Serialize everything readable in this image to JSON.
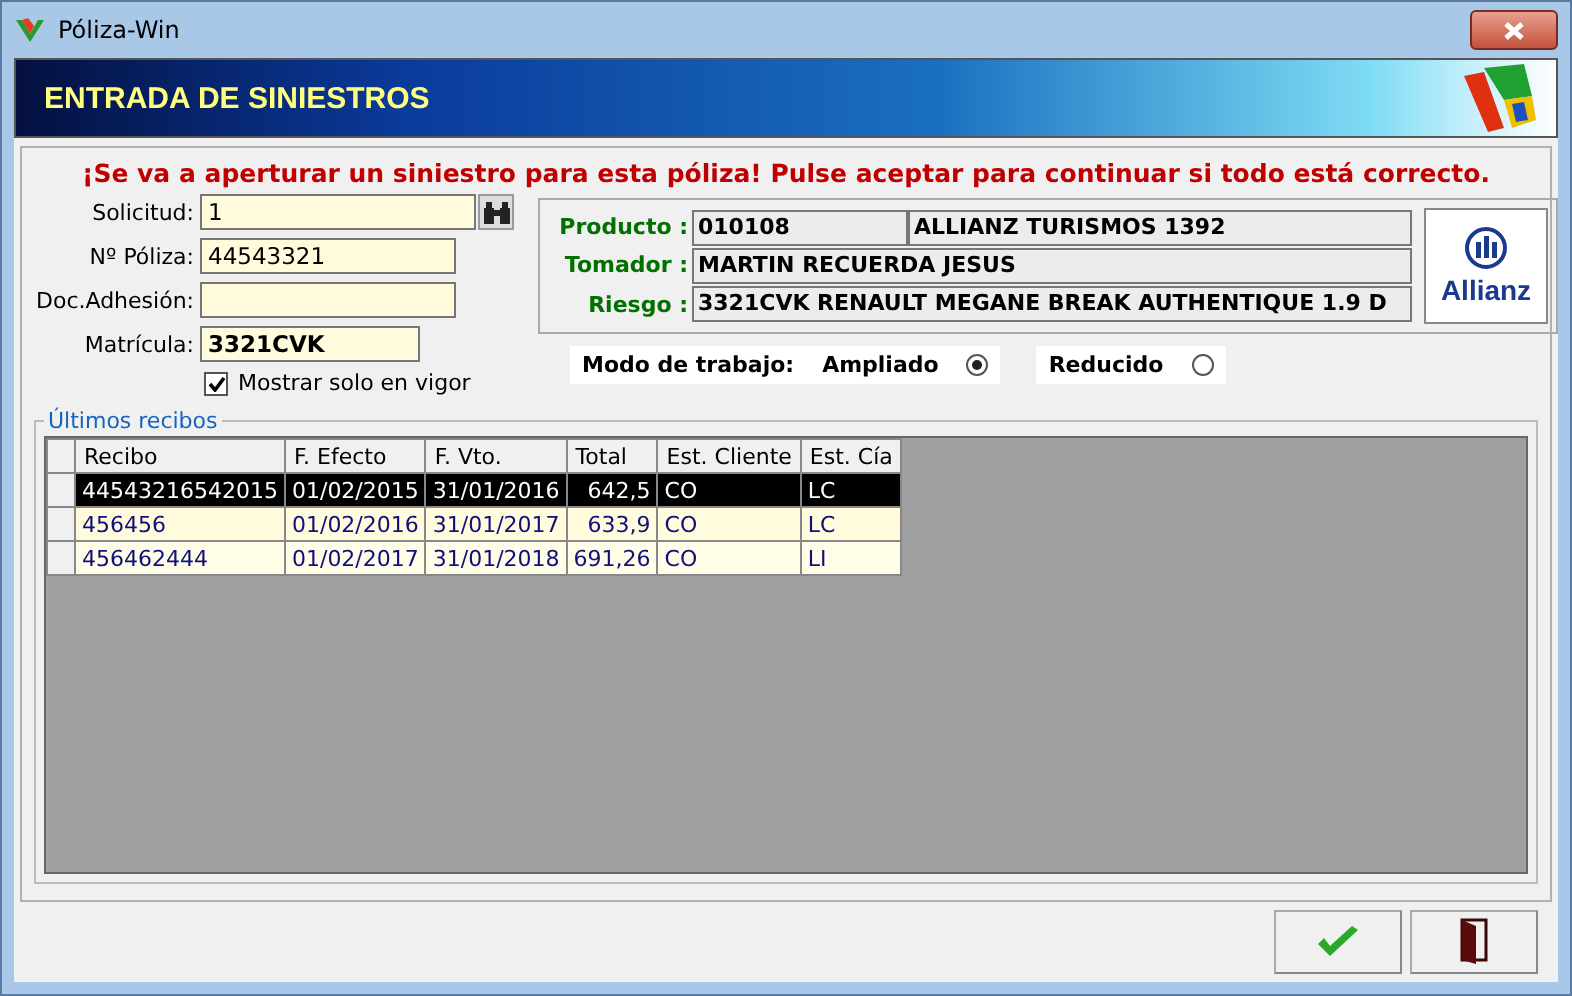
{
  "window": {
    "title": "Póliza-Win"
  },
  "banner": {
    "title": "ENTRADA DE SINIESTROS"
  },
  "warning": "¡Se va a aperturar un siniestro para esta póliza! Pulse aceptar para continuar si todo está correcto.",
  "fields": [
    {
      "label": "Solicitud:",
      "value": "1",
      "kind": "search"
    },
    {
      "label": "Nº Póliza:",
      "value": "44543321",
      "kind": "text"
    },
    {
      "label": "Doc.Adhesión:",
      "kind": "text"
    },
    {
      "label": "Matrícula:",
      "value": "3321CVK",
      "kind": "bold"
    }
  ],
  "only_in_force": {
    "label": "Mostrar solo en vigor",
    "checked": true
  },
  "policy": {
    "product_label": "Producto :",
    "product_code": "010108",
    "product_name": "ALLIANZ TURISMOS 1392",
    "holder_label": "Tomador :",
    "holder": "MARTIN RECUERDA JESUS",
    "risk_label": "Riesgo :",
    "risk": "3321CVK RENAULT MEGANE BREAK AUTHENTIQUE 1.9 D",
    "insurer_logo": "Allianz"
  },
  "work_mode": {
    "label": "Modo de trabajo:",
    "options": [
      {
        "label": "Ampliado",
        "selected": true
      },
      {
        "label": "Reducido",
        "selected": false
      }
    ]
  },
  "receipts": {
    "title": "Últimos recibos",
    "columns": [
      "Recibo",
      "F. Efecto",
      "F. Vto.",
      "Total",
      "Est. Cliente",
      "Est. Cía"
    ],
    "rows": [
      {
        "cells": [
          "44543216542015",
          "01/02/2015",
          "31/01/2016",
          "642,5",
          "CO",
          "LC"
        ],
        "selected": true
      },
      {
        "cells": [
          "456456",
          "01/02/2016",
          "31/01/2017",
          "633,9",
          "CO",
          "LC"
        ],
        "selected": false
      },
      {
        "cells": [
          "456462444",
          "01/02/2017",
          "31/01/2018",
          "691,26",
          "CO",
          "LI"
        ],
        "selected": false
      }
    ]
  }
}
